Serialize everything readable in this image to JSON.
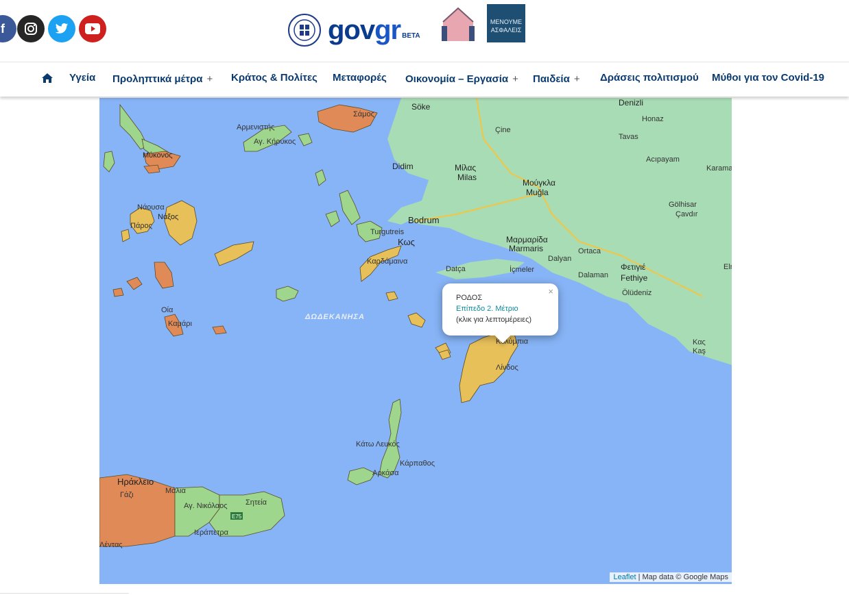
{
  "header": {
    "social": [
      {
        "name": "facebook",
        "icon": "facebook-icon",
        "color": "#3b5998"
      },
      {
        "name": "instagram",
        "icon": "instagram-icon",
        "color": "#262626"
      },
      {
        "name": "twitter",
        "icon": "twitter-icon",
        "color": "#1da1f2"
      },
      {
        "name": "youtube",
        "icon": "youtube-icon",
        "color": "#cd201f"
      }
    ],
    "brand": {
      "gov": "gov",
      "gr": "gr",
      "beta": "BETA"
    },
    "campaign1": "ΜΕΝΟΥΜΕ ΣΠΙΤΙ",
    "campaign2_line1": "ΜΕΝΟΥΜΕ",
    "campaign2_line2": "ΑΣΦΑΛΕΙΣ"
  },
  "nav": {
    "home_icon": "home-icon",
    "items": [
      {
        "label": "Υγεία",
        "has_submenu": false
      },
      {
        "label": "Προληπτικά μέτρα",
        "has_submenu": true
      },
      {
        "label": "Κράτος & Πολίτες",
        "has_submenu": false
      },
      {
        "label": "Μεταφορές",
        "has_submenu": false
      },
      {
        "label": "Οικονομία – Εργασία",
        "has_submenu": true
      },
      {
        "label": "Παιδεία",
        "has_submenu": true
      },
      {
        "label": "Δράσεις πολιτισμού",
        "has_submenu": false
      },
      {
        "label": "Μύθοι για τον Covid-19",
        "has_submenu": false
      }
    ],
    "plus_symbol": "+"
  },
  "map": {
    "labels": {
      "samos": "Σάμος",
      "armenistis": "Αρμενιστής",
      "kirikos": "Αγ. Κήρυκος",
      "mykonos": "Μύκονος",
      "naousa": "Νάουσα",
      "naxos": "Νάξος",
      "paros": "Πάρος",
      "oia": "Οία",
      "kamari": "Καμάρι",
      "dodecanese": "ΔΩΔΕΚΑΝΗΣΑ",
      "kos": "Κως",
      "forgutreis": "Turgutreis",
      "kardamaina": "Καρδάμαινα",
      "bodrum": "Bodrum",
      "didim": "Didim",
      "soke": "Söke",
      "cine": "Çine",
      "milas_gr": "Μίλας",
      "milas": "Milas",
      "mugla_gr": "Μούγκλα",
      "mugla": "Muğla",
      "denizli": "Denizli",
      "honaz": "Honaz",
      "tavas": "Tavas",
      "acipayam": "Acıpayam",
      "karaman": "Karama",
      "golhisar": "Gölhisar",
      "cavdir": "Çavdır",
      "marmaris_gr": "Μαρμαρίδα",
      "marmaris": "Marmaris",
      "dalyan": "Dalyan",
      "ortaca": "Ortaca",
      "dalaman": "Dalaman",
      "fethiye_gr": "Φετιγιέ",
      "fethiye": "Fethiye",
      "oludeniz": "Ölüdeniz",
      "datca": "Datça",
      "icmeler": "İçmeler",
      "kas_gr": "Κας",
      "kas": "Kaş",
      "elm": "Elm",
      "kolympia": "Κολύμπια",
      "lindos": "Λίνδος",
      "kato_lefkos": "Κάτω Λευκός",
      "karpathos": "Κάρπαθος",
      "arkasa": "Αρκάσα",
      "heraklion": "Ηράκλειο",
      "gazi": "Γάζι",
      "malia": "Μάλια",
      "agios_nikolaos": "Αγ. Νικόλαος",
      "sitia": "Σητεία",
      "ierapetra": "Ιεράπετρα",
      "lentas": "Λέντας",
      "e75": "E75"
    },
    "popup": {
      "title": "ΡΟΔΟΣ",
      "level": "Επίπεδο 2. Μέτριο",
      "hint": "(κλικ για λεπτομέρειες)",
      "close": "×"
    },
    "attribution": {
      "leaflet": "Leaflet",
      "separator": "|",
      "text": "Map data © Google Maps"
    },
    "colors": {
      "sea": "#87b4f6",
      "land": "#a8dcb5",
      "level_yellow": "#e8c05a",
      "level_orange": "#e08a58",
      "level_green": "#9fd68e"
    }
  }
}
